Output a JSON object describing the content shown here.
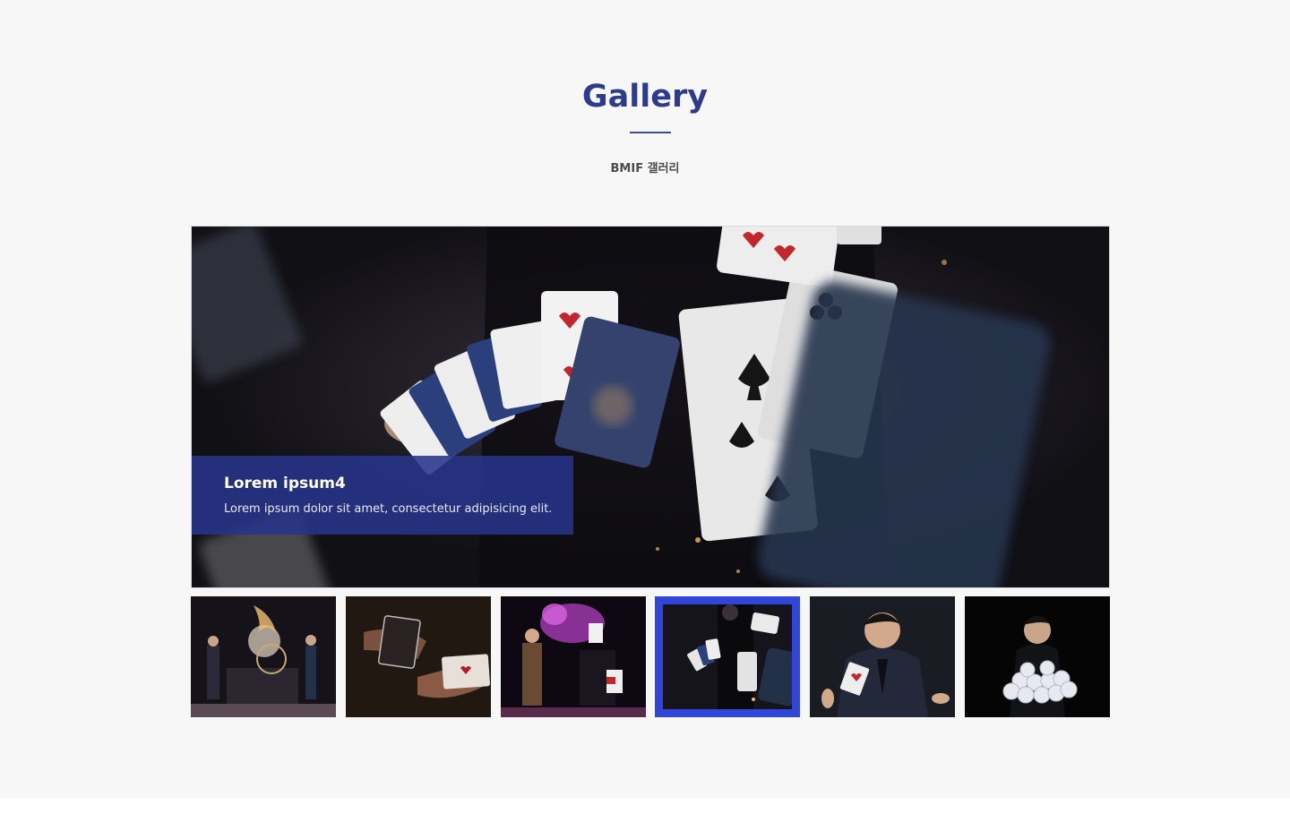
{
  "section": {
    "title": "Gallery",
    "subtitle": "BMIF 갤러리"
  },
  "slide": {
    "title": "Lorem ipsum4",
    "description": "Lorem ipsum dolor sit amet, consectetur adipisicing elit."
  },
  "thumbnails": [
    {
      "label": "stage-fire-act"
    },
    {
      "label": "hands-with-card"
    },
    {
      "label": "magician-purple-smoke"
    },
    {
      "label": "flying-cards",
      "active": true
    },
    {
      "label": "magician-with-card"
    },
    {
      "label": "magician-with-cds"
    }
  ],
  "colors": {
    "accent": "#2e3a8c",
    "caption_bg": "#27348a",
    "active_border": "#3146d9",
    "page_bg": "#f7f7f7"
  }
}
